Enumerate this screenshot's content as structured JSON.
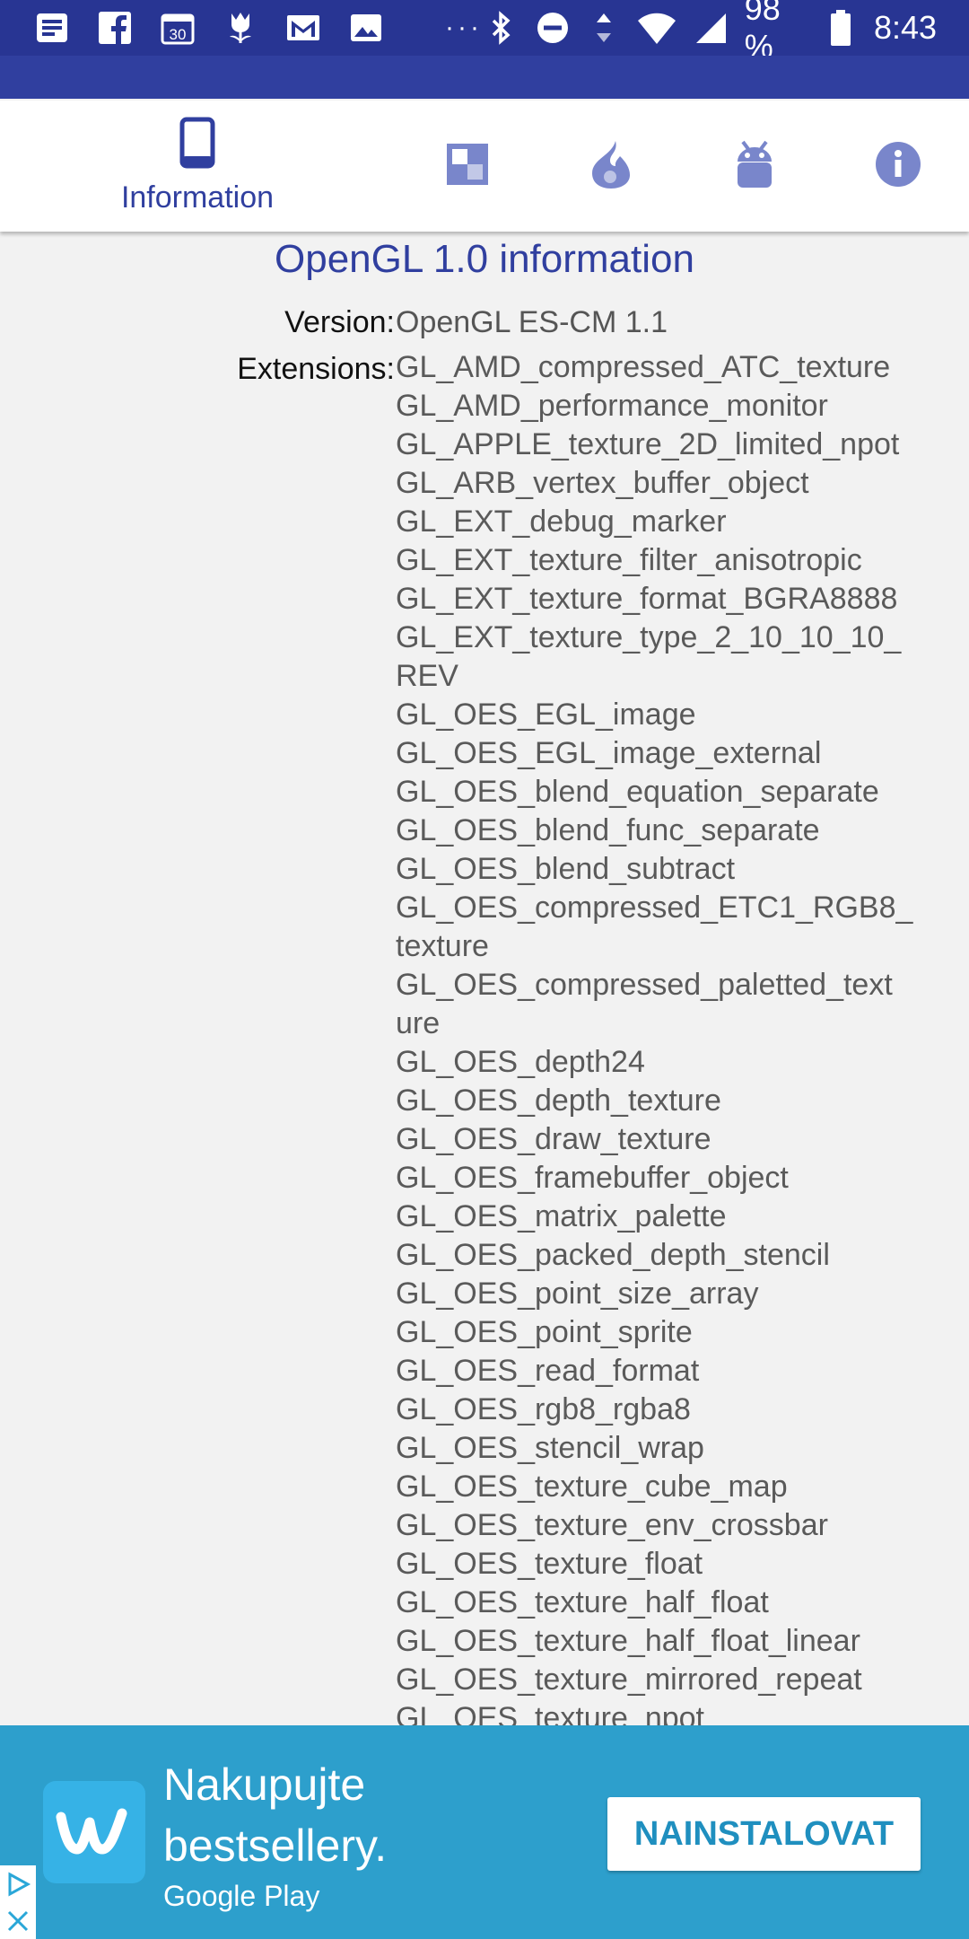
{
  "status_bar": {
    "icons_left": [
      "notes-icon",
      "facebook-icon",
      "calendar-icon",
      "tulip-icon",
      "gmail-icon",
      "gallery-icon"
    ],
    "calendar_day": "30",
    "overflow": "···",
    "icons_right": [
      "bluetooth-icon",
      "dnd-icon",
      "data-arrows-icon",
      "wifi-icon",
      "signal-icon"
    ],
    "battery": "98 %",
    "time": "8:43",
    "color": "#283593"
  },
  "tabs": {
    "information_label": "Information",
    "accent": "#303f9f",
    "icon_color": "#7986cb",
    "items": [
      "phone-icon",
      "display-icon",
      "flame-icon",
      "android-icon",
      "info-icon"
    ]
  },
  "main": {
    "heading": "OpenGL 1.0 information",
    "version_label": "Version:",
    "version_value": "OpenGL ES-CM 1.1",
    "extensions_label": "Extensions:",
    "extensions": [
      "GL_AMD_compressed_ATC_texture",
      "GL_AMD_performance_monitor",
      "GL_APPLE_texture_2D_limited_npot",
      "GL_ARB_vertex_buffer_object",
      "GL_EXT_debug_marker",
      "GL_EXT_texture_filter_anisotropic",
      "GL_EXT_texture_format_BGRA8888",
      "GL_EXT_texture_type_2_10_10_10_",
      "REV",
      "GL_OES_EGL_image",
      "GL_OES_EGL_image_external",
      "GL_OES_blend_equation_separate",
      "GL_OES_blend_func_separate",
      "GL_OES_blend_subtract",
      "GL_OES_compressed_ETC1_RGB8_",
      "texture",
      "GL_OES_compressed_paletted_text",
      "ure",
      "GL_OES_depth24",
      "GL_OES_depth_texture",
      "GL_OES_draw_texture",
      "GL_OES_framebuffer_object",
      "GL_OES_matrix_palette",
      "GL_OES_packed_depth_stencil",
      "GL_OES_point_size_array",
      "GL_OES_point_sprite",
      "GL_OES_read_format",
      "GL_OES_rgb8_rgba8",
      "GL_OES_stencil_wrap",
      "GL_OES_texture_cube_map",
      "GL_OES_texture_env_crossbar",
      "GL_OES_texture_float",
      "GL_OES_texture_half_float",
      "GL_OES_texture_half_float_linear",
      "GL_OES_texture_mirrored_repeat",
      "GL_OES_texture_npot"
    ]
  },
  "ad": {
    "title": "Nakupujte bestsellery.",
    "store": "Google Play",
    "button": "NAINSTALOVAT",
    "logo_letter": "w",
    "background": "#2d9fcc",
    "button_text_color": "#1f8fbf",
    "badges": [
      "adchoices-icon",
      "close-icon"
    ]
  }
}
